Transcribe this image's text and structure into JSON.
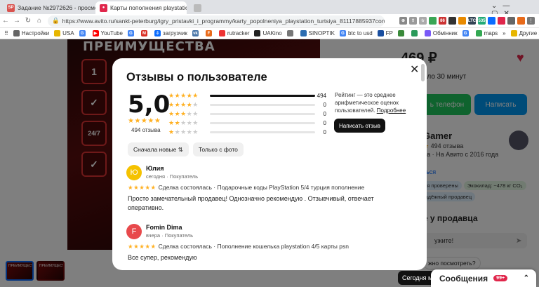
{
  "browser": {
    "tabs": [
      {
        "favicon": "SP",
        "title": "Задание №2972626 - просмотр з"
      },
      {
        "favicon": "A",
        "title": "Карты пополнения playstation тур"
      },
      {
        "favicon": "",
        "title": ""
      }
    ],
    "url": "https://www.avito.ru/sankt-peterburg/igry_pristavki_i_programmy/karty_popolneniya_playstation_turtsiya_81117885937cont...",
    "ext_labels": [
      "86",
      "LTC",
      "535"
    ],
    "bookmarks": [
      "Настройки",
      "USA",
      "",
      "YouTube",
      "",
      "",
      "загрузчик",
      "",
      "",
      "rutracker",
      "UAKino",
      "",
      "SINOPTIK",
      "btc to usd",
      "FP",
      "",
      "",
      "Обмінник",
      "",
      "maps"
    ],
    "bookmarks_other": "Другие закладки"
  },
  "background": {
    "banner_title": "ПРЕИМУЩЕСТВА",
    "banner_icons": [
      "1",
      "✓",
      "24/7",
      "✓"
    ],
    "thumb1": "ПРЕИМУЩЕСТВА",
    "thumb2": "ПРЕИМУЩЕСТВА",
    "price": "469 ₽",
    "wait": "около 30 минут",
    "btn_phone": "ь телефон",
    "btn_write": "Написать",
    "seller_name": "Gamer",
    "seller_reviews": "494 отзыва",
    "seller_since": "ца · На Авито с 2016 года",
    "seller_link": "ться",
    "chips": [
      "рия проверены",
      "Экокилад: ~478 кг CO₂",
      "Надёжный продавец"
    ],
    "ask_title": "те у продавца",
    "ask_value": "ужите!",
    "ask_question": "жно посмотреть?",
    "msg_label": "Сегодня мо",
    "soob_label": "Сообщения",
    "soob_badge": "99+"
  },
  "modal": {
    "title": "Отзывы о пользователе",
    "rating": "5,0",
    "rating_stars": "★★★★★",
    "reviews_count": "494 отзыва",
    "histogram": [
      {
        "stars": 5,
        "count": 494,
        "fill": 1.0
      },
      {
        "stars": 4,
        "count": 0,
        "fill": 0
      },
      {
        "stars": 3,
        "count": 0,
        "fill": 0
      },
      {
        "stars": 2,
        "count": 0,
        "fill": 0
      },
      {
        "stars": 1,
        "count": 0,
        "fill": 0
      }
    ],
    "hist_counts": [
      "494",
      "0",
      "0",
      "0",
      "0"
    ],
    "note": "Рейтинг — это среднее арифметическое оценок пользователей.",
    "note_link": "Подробнее",
    "write_button": "Написать отзыв",
    "filter_new": "Сначала новые ⇅",
    "filter_photo": "Только с фото",
    "reviews": [
      {
        "initial": "Ю",
        "avatar_color": "#f5c200",
        "name": "Юлия",
        "meta": "сегодня · Покупатель",
        "stars": "★★★★★",
        "deal": "Сделка состоялась · Подарочные коды PlayStation 5/4 турция пополнение",
        "text": "Просто замечательный продавец! Однозначно рекомендую . Отзывчивый, отвечает оперативно."
      },
      {
        "initial": "F",
        "avatar_color": "#e8494c",
        "name": "Fomin Dima",
        "meta": "вчера · Покупатель",
        "stars": "★★★★★",
        "deal": "Сделка состоялась · Пополнение кошелька playstation 4/5 карты psn",
        "text": "Все супер, рекомендую"
      }
    ]
  },
  "colors": {
    "star": "#ffb021",
    "accent_green": "#1fc65c",
    "accent_blue": "#0097f0",
    "avito_red": "#e0264b"
  }
}
